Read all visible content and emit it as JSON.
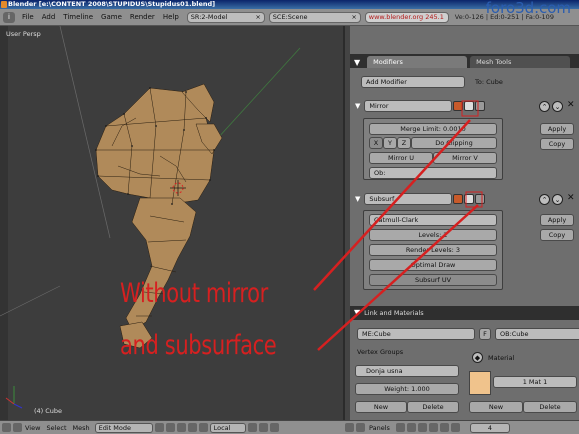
{
  "titlebar": {
    "title": "Blender [e:\\CONTENT 2008\\STUPIDUS\\Stupidus01.blend]"
  },
  "watermark": "foro3d.com",
  "menubar": {
    "menus": [
      "File",
      "Add",
      "Timeline",
      "Game",
      "Render",
      "Help"
    ],
    "screen": "SR:2-Model",
    "scene": "SCE:Scene",
    "url": "www.blender.org 245.1",
    "stats": "Ve:0-126 | Ed:0-251 | Fa:0-109"
  },
  "viewport": {
    "label": "User Persp",
    "object_label": "(4) Cube"
  },
  "viewport_toolbar": {
    "view": "View",
    "select": "Select",
    "mesh": "Mesh",
    "mode": "Edit Mode",
    "pivot": "Local"
  },
  "panel": {
    "tabs": [
      "Modifiers",
      "Mesh Tools"
    ],
    "add_modifier": "Add Modifier",
    "to_object": "To: Cube",
    "mirror": {
      "name": "Mirror",
      "merge_limit": "Merge Limit: 0.0010",
      "axes": [
        "X",
        "Y",
        "Z"
      ],
      "do_clipping": "Do Clipping",
      "mirror_u": "Mirror U",
      "mirror_v": "Mirror V",
      "ob": "Ob:",
      "apply": "Apply",
      "copy": "Copy"
    },
    "subsurf": {
      "name": "Subsurf",
      "type": "Catmull-Clark",
      "levels": "Levels: 2",
      "render_levels": "Render Levels: 3",
      "optimal_draw": "Optimal Draw",
      "subsurf_uv": "Subsurf UV",
      "apply": "Apply",
      "copy": "Copy"
    },
    "materials": {
      "title": "Link and Materials",
      "me": "ME:Cube",
      "f": "F",
      "ob": "OB:Cube",
      "vertex_groups": "Vertex Groups",
      "group_name": "Donja usna",
      "weight": "Weight: 1.000",
      "new": "New",
      "delete": "Delete",
      "material": "Material",
      "mat": "1 Mat 1",
      "new2": "New",
      "delete2": "Delete"
    }
  },
  "panels_bar": {
    "label": "Panels",
    "page": "4"
  },
  "annotation": {
    "line1": "Without mirror",
    "line2": "and subsurface"
  },
  "colors": {
    "annotation": "#d62020",
    "swatch": "#f0c38c",
    "mesh": "#b08a5a"
  }
}
